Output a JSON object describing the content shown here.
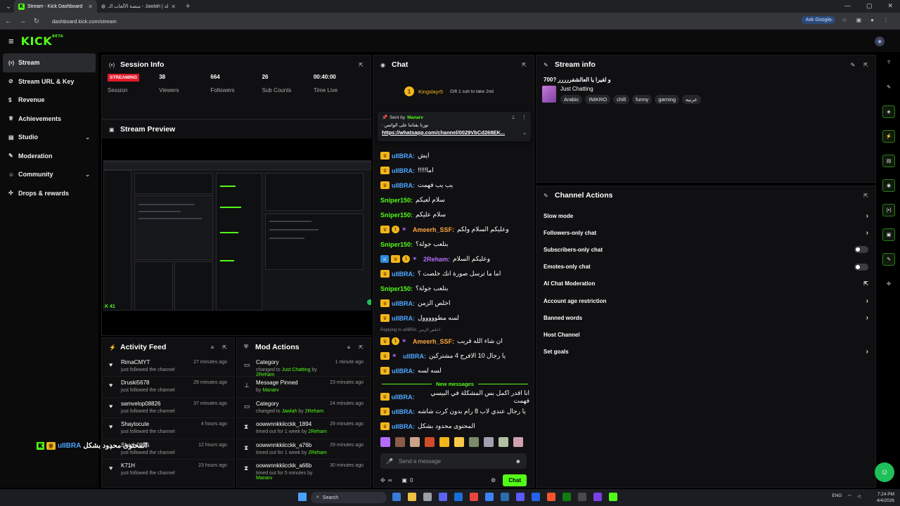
{
  "browser": {
    "tabs": [
      {
        "title": "Stream - Kick Dashboard",
        "active": true
      },
      {
        "title": "منصة الألعاب الـ - Jawlah | جولة",
        "active": false
      }
    ],
    "url": "dashboard.kick.com/stream",
    "ask_google": "Ask Google"
  },
  "app": {
    "logo": "KICK",
    "beta": "BETA"
  },
  "sidebar": {
    "items": [
      {
        "label": "Stream",
        "icon": "broadcast-icon",
        "active": true,
        "chevron": false
      },
      {
        "label": "Stream URL & Key",
        "icon": "link-icon",
        "active": false,
        "chevron": false
      },
      {
        "label": "Revenue",
        "icon": "dollar-icon",
        "active": false,
        "chevron": false
      },
      {
        "label": "Achievements",
        "icon": "trophy-icon",
        "active": false,
        "chevron": false
      },
      {
        "label": "Studio",
        "icon": "studio-icon",
        "active": false,
        "chevron": true
      },
      {
        "label": "Moderation",
        "icon": "wrench-icon",
        "active": false,
        "chevron": false
      },
      {
        "label": "Community",
        "icon": "people-icon",
        "active": false,
        "chevron": true
      },
      {
        "label": "Drops & rewards",
        "icon": "gift-icon",
        "active": false,
        "chevron": false
      }
    ]
  },
  "session": {
    "title": "Session Info",
    "status_badge": "STREAMING",
    "stats": [
      {
        "value": "",
        "label": "Session"
      },
      {
        "value": "38",
        "label": "Viewers"
      },
      {
        "value": "664",
        "label": "Followers"
      },
      {
        "value": "26",
        "label": "Sub Counts"
      },
      {
        "value": "00:40:00",
        "label": "Time Live"
      }
    ]
  },
  "preview": {
    "title": "Stream Preview",
    "corner_tag": "K 41"
  },
  "activity": {
    "title": "Activity Feed",
    "rows": [
      {
        "name": "RimaCMYT",
        "sub": "just followed the channel",
        "time": "27 minutes ago"
      },
      {
        "name": "Druski5678",
        "sub": "just followed the channel",
        "time": "29 minutes ago"
      },
      {
        "name": "samvelop08826",
        "sub": "just followed the channel",
        "time": "37 minutes ago"
      },
      {
        "name": "Shaytocute",
        "sub": "just followed the channel",
        "time": "4 hours ago"
      },
      {
        "name": "Shady0825",
        "sub": "just followed the channel",
        "time": "12 hours ago"
      },
      {
        "name": "K71H",
        "sub": "just followed the channel",
        "time": "23 hours ago"
      }
    ]
  },
  "mod": {
    "title": "Mod Actions",
    "rows": [
      {
        "icon": "category-icon",
        "title": "Category",
        "sub_pre": "changed to ",
        "sub_hl": "Just Chatting",
        "sub_mid": " by ",
        "sub_user": "2Reham",
        "time": "1 minute ago"
      },
      {
        "icon": "pin-icon",
        "title": "Message Pinned",
        "sub_pre": "by ",
        "sub_hl": "",
        "sub_mid": "",
        "sub_user": "Manarv",
        "time": "23 minutes ago"
      },
      {
        "icon": "category-icon",
        "title": "Category",
        "sub_pre": "changed to ",
        "sub_hl": "Jawlah",
        "sub_mid": " by ",
        "sub_user": "2Reham",
        "time": "24 minutes ago"
      },
      {
        "icon": "hourglass-icon",
        "title": "oowwnnkkiicckk_1894",
        "sub_pre": "timed out for 1 week by ",
        "sub_hl": "",
        "sub_mid": "",
        "sub_user": "2Reham",
        "time": "29 minutes ago"
      },
      {
        "icon": "hourglass-icon",
        "title": "oowwnnkkiicckk_a76b",
        "sub_pre": "timed out for 1 week by ",
        "sub_hl": "",
        "sub_mid": "",
        "sub_user": "2Reham",
        "time": "29 minutes ago"
      },
      {
        "icon": "hourglass-icon",
        "title": "oowwnnkkiicckk_a66b",
        "sub_pre": "timed out for 5 minutes by ",
        "sub_hl": "",
        "sub_mid": "",
        "sub_user": "Manarv",
        "time": "30 minutes ago"
      }
    ]
  },
  "chat": {
    "title": "Chat",
    "gifter": {
      "name": "Kingslayr5",
      "text": "Gift 1 sub to take 2nd"
    },
    "pinned": {
      "sent_by_label": "Sent by",
      "user": "Manarv",
      "text": "نورنا بقناتنا على الواتس :",
      "link": "https://whatsapp.com/channel/0029VbCd268EK..."
    },
    "messages": [
      {
        "badges": [
          "crown"
        ],
        "user": "uIIBRA",
        "color": "blue",
        "text": "ايش"
      },
      {
        "badges": [
          "crown"
        ],
        "user": "uIIBRA",
        "color": "blue",
        "text": "اما!!!!!"
      },
      {
        "badges": [
          "crown"
        ],
        "user": "uIIBRA",
        "color": "blue",
        "text": "يب يب فهمت"
      },
      {
        "badges": [],
        "user": "Sniper150",
        "color": "green",
        "text": "سلام لعيكم"
      },
      {
        "badges": [],
        "user": "Sniper150",
        "color": "green",
        "text": "سلام عليكم"
      },
      {
        "badges": [
          "crown",
          "gold",
          "lili"
        ],
        "user": "Ameerh_SSF",
        "color": "orange",
        "text": "وعليكم السلام ولكم"
      },
      {
        "badges": [],
        "user": "Sniper150",
        "color": "green",
        "text": "بنلعب جولة؟"
      },
      {
        "badges": [
          "blue",
          "crown",
          "gold",
          "lili"
        ],
        "user": "2Reham",
        "color": "purple",
        "text": "وعليكم السلام"
      },
      {
        "badges": [
          "crown"
        ],
        "user": "uIIBRA",
        "color": "blue",
        "text": "اما ما ترسل صورة انك خلصت ؟"
      },
      {
        "badges": [],
        "user": "Sniper150",
        "color": "green",
        "text": "بنلعب جولة؟"
      },
      {
        "badges": [
          "crown"
        ],
        "user": "uIIBRA",
        "color": "blue",
        "text": "اخلص الزمن"
      },
      {
        "badges": [
          "crown"
        ],
        "user": "uIIBRA",
        "color": "blue",
        "text": "لسه مطووووول"
      }
    ],
    "reply_label": "Replying to uIIBRA: اخلص الزمن",
    "messages_after": [
      {
        "badges": [
          "crown",
          "gold",
          "lili"
        ],
        "user": "Ameerh_SSF",
        "color": "orange",
        "text": "ان شاء الله قريب"
      },
      {
        "badges": [
          "crown",
          "lili"
        ],
        "user": "uIIBRA",
        "color": "blue",
        "text": "يا رجال 10 الافرج 4 مشتركين"
      },
      {
        "badges": [
          "crown"
        ],
        "user": "uIIBRA",
        "color": "blue",
        "text": "لسه لسه"
      }
    ],
    "new_messages_label": "New messages",
    "messages_new": [
      {
        "badges": [
          "crown"
        ],
        "user": "uIIBRA",
        "color": "blue",
        "text": "انا اقدر اكمل بس المشكلة في البيسي فهمت"
      },
      {
        "badges": [
          "crown"
        ],
        "user": "uIIBRA",
        "color": "blue",
        "text": "يا رجال عندي لاب 8 رام بدون كرت شاشه"
      },
      {
        "badges": [
          "crown"
        ],
        "user": "uIIBRA",
        "color": "blue",
        "text": "المحتوى محدود بشكل"
      }
    ],
    "input_placeholder": "Send a message",
    "infinity": "∞",
    "points": "0",
    "send_label": "Chat"
  },
  "stream_info": {
    "title": "Stream info",
    "stream_title": "و لقيرا يا العالشفررررر ?700",
    "category": "Just Chatting",
    "tags": [
      "Arabic",
      "INIKRO",
      "chill",
      "funny",
      "gaming",
      "عربيه"
    ]
  },
  "channel_actions": {
    "title": "Channel Actions",
    "rows": [
      {
        "label": "Slow mode",
        "control": "chevron"
      },
      {
        "label": "Followers-only chat",
        "control": "chevron"
      },
      {
        "label": "Subscribers-only chat",
        "control": "toggle"
      },
      {
        "label": "Emotes-only chat",
        "control": "toggle"
      },
      {
        "label": "AI Chat Moderation",
        "control": "external"
      },
      {
        "label": "Account age restriction",
        "control": "chevron"
      },
      {
        "label": "Banned words",
        "control": "chevron"
      },
      {
        "label": "Host Channel",
        "control": "none"
      },
      {
        "label": "Set goals",
        "control": "chevron"
      }
    ]
  },
  "overlay": {
    "user": "uIIBRA",
    "text": "المحتوى محدود بشكل",
    "k41_number": "41"
  },
  "taskbar": {
    "search_label": "Search",
    "lang": "ENG",
    "time": "7:24 PM",
    "date": "4/4/2026"
  },
  "colors": {
    "brand": "#53fc18",
    "live": "#e1192b",
    "background": "#000000",
    "panel": "#101012"
  }
}
